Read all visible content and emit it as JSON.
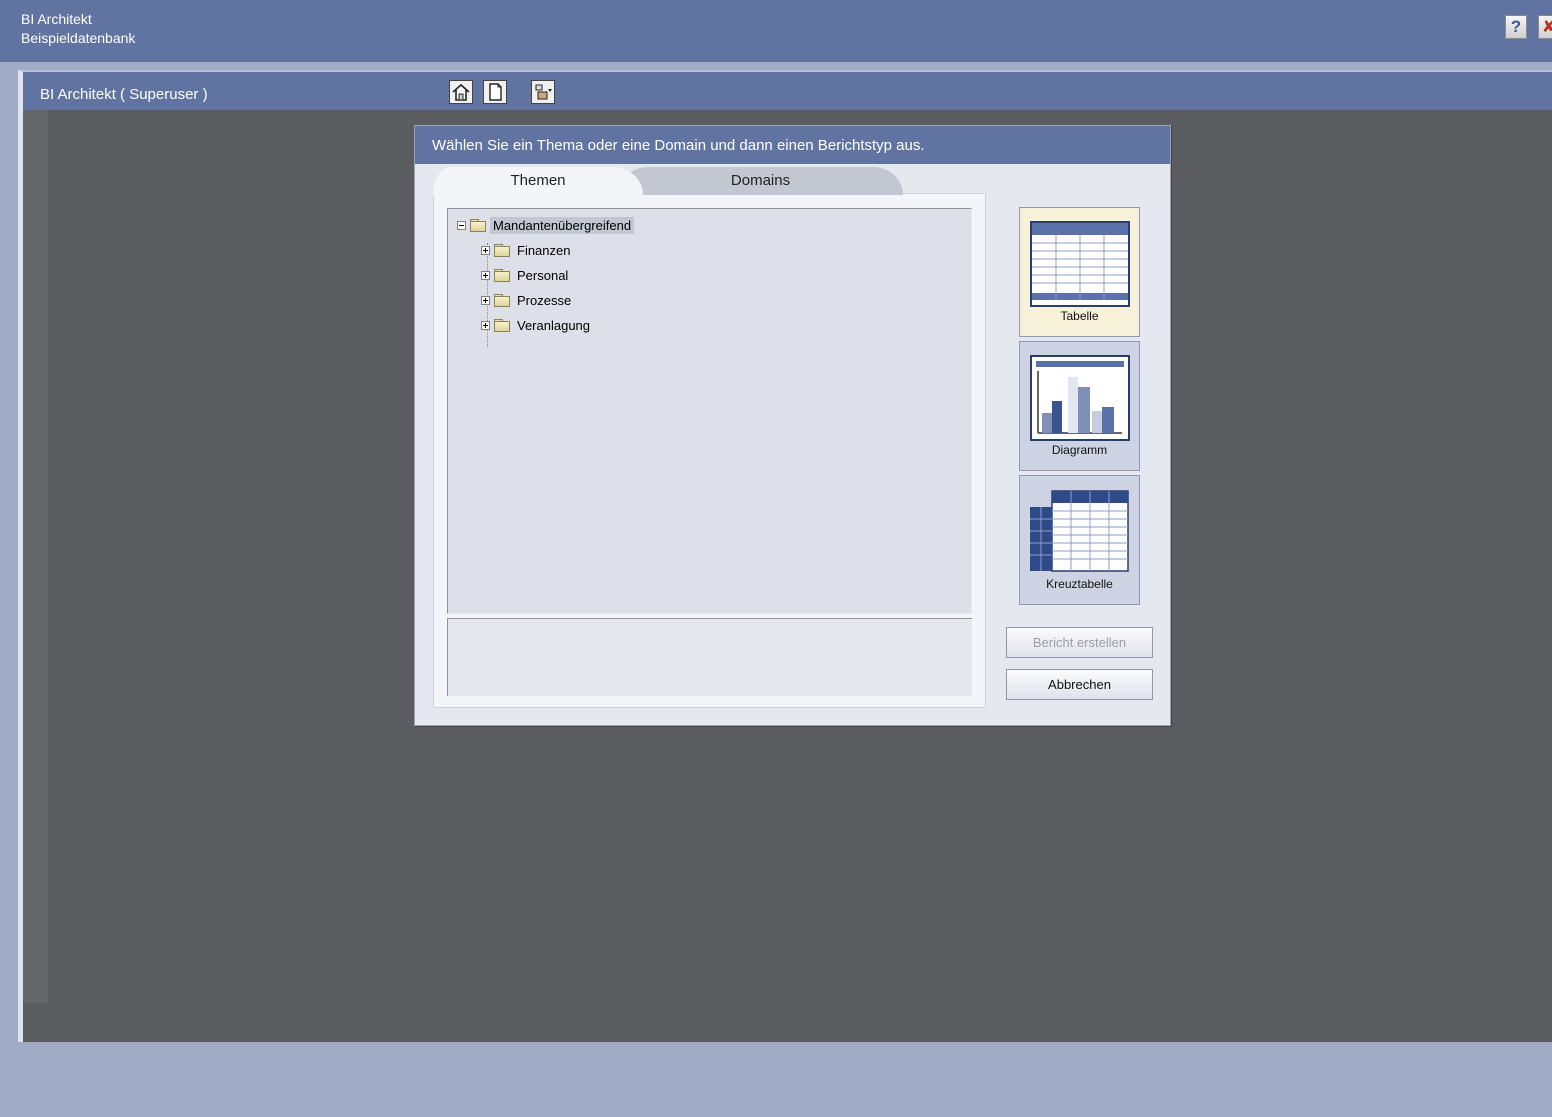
{
  "header": {
    "app_name": "BI Architekt",
    "database": "Beispieldatenbank",
    "help_label": "?",
    "logout_label": "✘"
  },
  "workspace": {
    "title": "BI Architekt ( Superuser )",
    "toolbar": [
      "home-icon",
      "new-document-icon",
      "tools-icon"
    ]
  },
  "dialog": {
    "title": "Wählen Sie ein Thema oder eine Domain und dann einen Berichtstyp aus.",
    "tabs": {
      "themen": "Themen",
      "domains": "Domains"
    },
    "tree": {
      "root": "Mandantenübergreifend",
      "children": [
        "Finanzen",
        "Personal",
        "Prozesse",
        "Veranlagung"
      ]
    },
    "report_types": {
      "tabelle": "Tabelle",
      "diagramm": "Diagramm",
      "kreuztabelle": "Kreuztabelle"
    },
    "buttons": {
      "create": "Bericht erstellen",
      "cancel": "Abbrechen"
    }
  },
  "colors": {
    "header_bg": "#6173a0",
    "workspace_bg": "#5b5c60",
    "dialog_bg": "#e6e8ef",
    "selected_type_bg": "#f6f1d8"
  }
}
